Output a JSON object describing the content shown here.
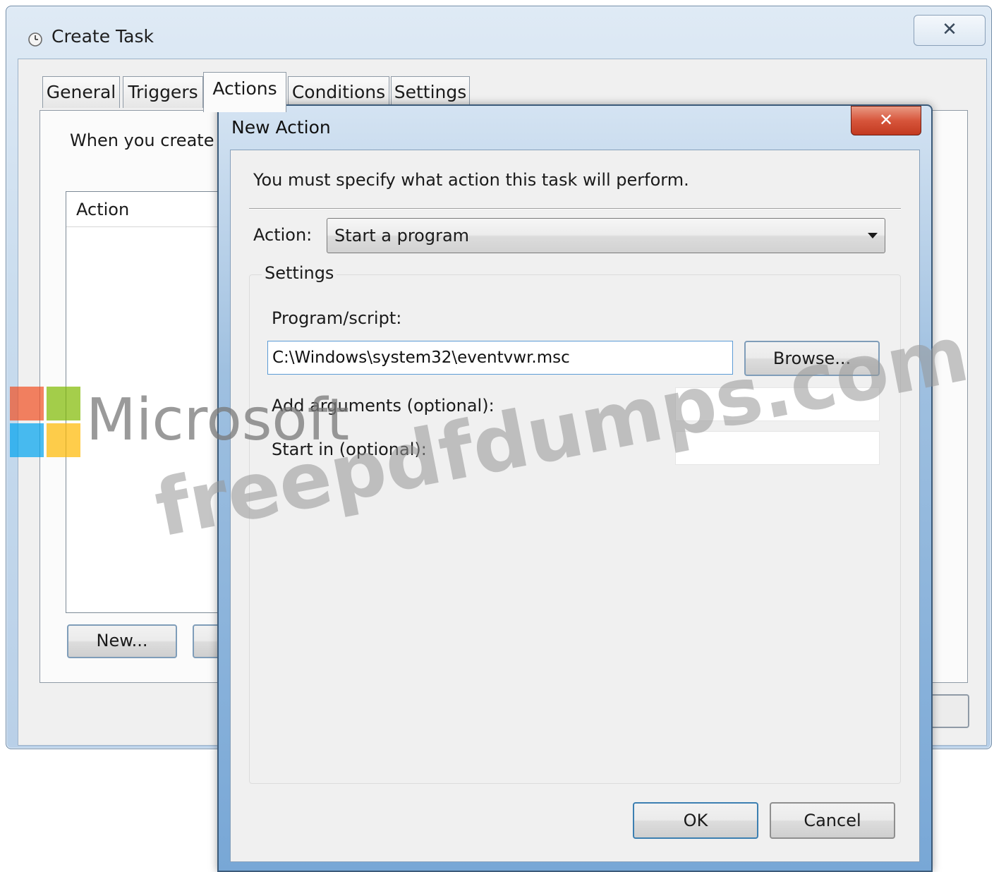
{
  "outer_window": {
    "title": "Create Task",
    "close_glyph": "✕",
    "tabs": [
      {
        "label": "General"
      },
      {
        "label": "Triggers"
      },
      {
        "label": "Actions"
      },
      {
        "label": "Conditions"
      },
      {
        "label": "Settings"
      }
    ],
    "active_tab": "Actions",
    "description": "When you create a",
    "action_list_header": "Action",
    "new_button": "New..."
  },
  "dialog": {
    "title": "New Action",
    "close_glyph": "✕",
    "message": "You must specify what action this task will perform.",
    "action_label": "Action:",
    "action_value": "Start a program",
    "settings_label": "Settings",
    "program_label": "Program/script:",
    "program_value": "C:\\Windows\\system32\\eventvwr.msc",
    "browse_button": "Browse...",
    "arguments_label": "Add arguments (optional):",
    "arguments_value": "",
    "start_in_label": "Start in (optional):",
    "start_in_value": "",
    "ok_button": "OK",
    "cancel_button": "Cancel"
  },
  "watermark": {
    "brand": "Microsoft",
    "site": "freepdfdumps.com",
    "logo_colors": [
      "#f25022",
      "#7fba00",
      "#00a4ef",
      "#ffb900"
    ]
  },
  "icons": {
    "title_icon": "clock-icon",
    "dropdown_icon": "chevron-down-icon"
  }
}
